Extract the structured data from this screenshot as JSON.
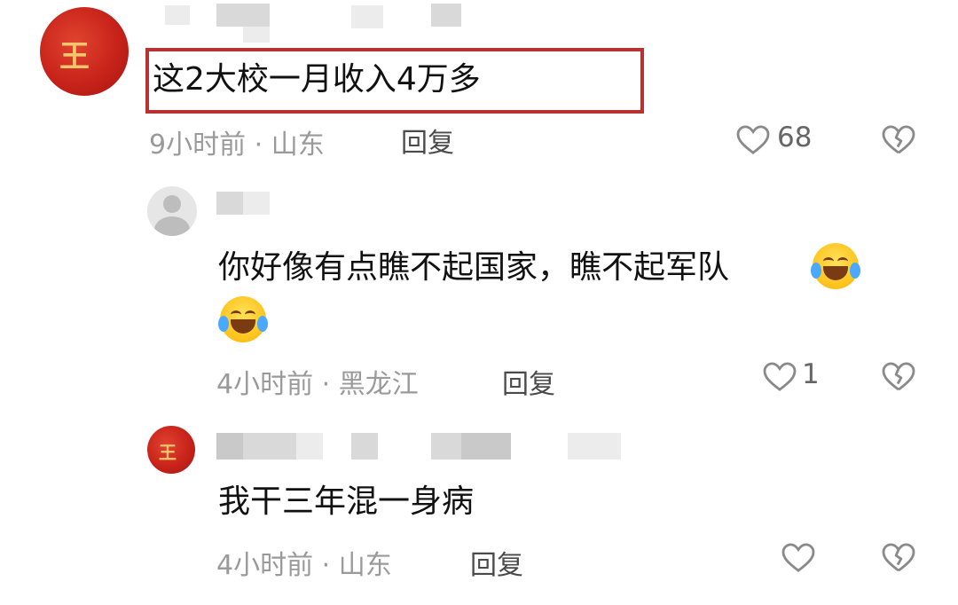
{
  "comments": [
    {
      "text": "这2大校一月收入4万多",
      "time": "9小时前",
      "region": "山东",
      "reply_label": "回复",
      "likes": "68"
    },
    {
      "text_line1": "你好像有点瞧不起国家，瞧不起军队",
      "time": "4小时前",
      "region": "黑龙江",
      "reply_label": "回复",
      "likes": "1"
    },
    {
      "text": "我干三年混一身病",
      "time": "4小时前",
      "region": "山东",
      "reply_label": "回复",
      "likes": ""
    }
  ],
  "separator": "·",
  "icons": {
    "like": "heart-outline-icon",
    "dislike": "broken-heart-icon",
    "emoji": "laughing-tears-emoji"
  },
  "colors": {
    "highlight_border": "#b8332f",
    "meta_text": "#9a9a9a"
  }
}
